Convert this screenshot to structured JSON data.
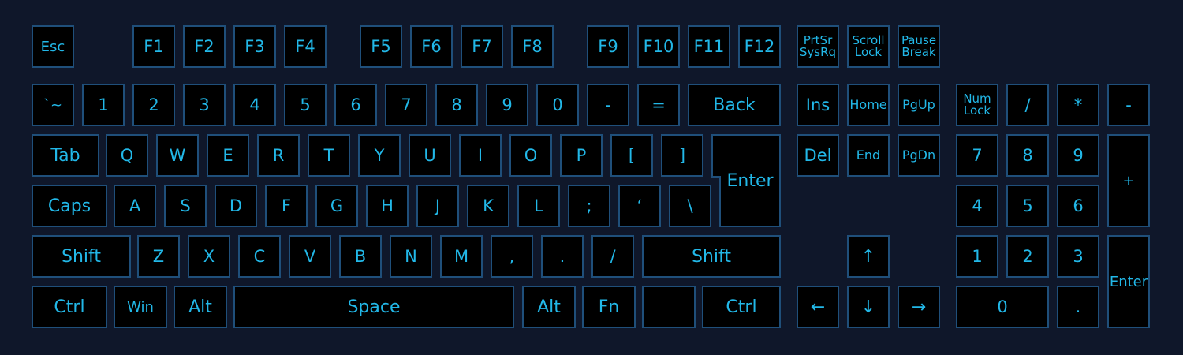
{
  "colors": {
    "background": "#0f172a",
    "key_fill": "#000000",
    "key_border": "#1f4f7a",
    "legend": "#22b8e8"
  },
  "keys": {
    "esc": "Esc",
    "f1": "F1",
    "f2": "F2",
    "f3": "F3",
    "f4": "F4",
    "f5": "F5",
    "f6": "F6",
    "f7": "F7",
    "f8": "F8",
    "f9": "F9",
    "f10": "F10",
    "f11": "F11",
    "f12": "F12",
    "prtsc": "PrtSr\nSysRq",
    "scroll_lock": "Scroll\nLock",
    "pause": "Pause\nBreak",
    "backtick": "`~",
    "d1": "1",
    "d2": "2",
    "d3": "3",
    "d4": "4",
    "d5": "5",
    "d6": "6",
    "d7": "7",
    "d8": "8",
    "d9": "9",
    "d0": "0",
    "minus": "-",
    "equals": "=",
    "back": "Back",
    "ins": "Ins",
    "home": "Home",
    "pgup": "PgUp",
    "numlock": "Num\nLock",
    "np_div": "/",
    "np_mul": "*",
    "np_sub": "-",
    "tab": "Tab",
    "q": "Q",
    "w": "W",
    "e": "E",
    "r": "R",
    "t": "T",
    "y": "Y",
    "u": "U",
    "i": "I",
    "o": "O",
    "p": "P",
    "lbracket": "[",
    "rbracket": "]",
    "enter": "Enter",
    "del": "Del",
    "end": "End",
    "pgdn": "PgDn",
    "np7": "7",
    "np8": "8",
    "np9": "9",
    "np_add": "+",
    "caps": "Caps",
    "a": "A",
    "s": "S",
    "d": "D",
    "f": "F",
    "g": "G",
    "h": "H",
    "j": "J",
    "k": "K",
    "l": "L",
    "semicolon": ";",
    "quote": "‘",
    "backslash": "\\",
    "np4": "4",
    "np5": "5",
    "np6": "6",
    "shift_l": "Shift",
    "z": "Z",
    "x": "X",
    "c": "C",
    "v": "V",
    "b": "B",
    "n": "N",
    "m": "M",
    "comma": ",",
    "period": ".",
    "slash": "/",
    "shift_r": "Shift",
    "up": "↑",
    "np1": "1",
    "np2": "2",
    "np3": "3",
    "np_enter": "Enter",
    "ctrl_l": "Ctrl",
    "win": "Win",
    "alt_l": "Alt",
    "space": "Space",
    "alt_r": "Alt",
    "fn": "Fn",
    "blank": "",
    "ctrl_r": "Ctrl",
    "left": "←",
    "down": "↓",
    "right": "→",
    "np0": "0",
    "np_dot": "."
  }
}
